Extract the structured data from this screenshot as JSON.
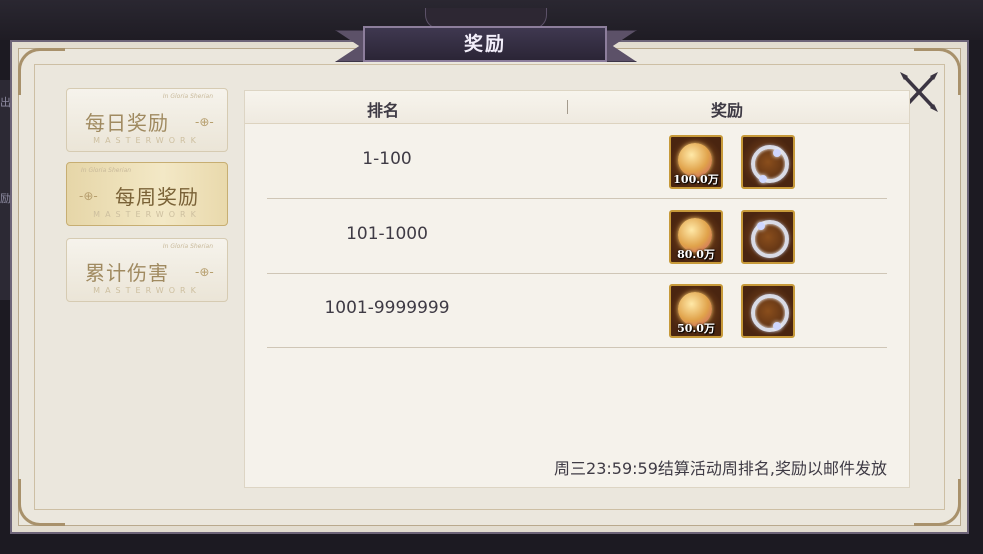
{
  "title": "奖励",
  "tabs": [
    {
      "label": "每日奖励",
      "sub": "MASTERWORK",
      "tiny": "In Gloria Sherian",
      "active": false
    },
    {
      "label": "每周奖励",
      "sub": "MASTERWORK",
      "tiny": "In Gloria Sherian",
      "active": true
    },
    {
      "label": "累计伤害",
      "sub": "MASTERWORK",
      "tiny": "In Gloria Sherian",
      "active": false
    }
  ],
  "table": {
    "headers": {
      "rank": "排名",
      "reward": "奖励"
    },
    "rows": [
      {
        "rank": "1-100",
        "coin_qty": "100.0万",
        "item2": "ring-icon"
      },
      {
        "rank": "101-1000",
        "coin_qty": "80.0万",
        "item2": "ring-icon"
      },
      {
        "rank": "1001-9999999",
        "coin_qty": "50.0万",
        "item2": "ring-icon"
      }
    ]
  },
  "footer_note": "周三23:59:59结算活动周排名,奖励以邮件发放",
  "background_side_text": [
    "出",
    "励"
  ],
  "colors": {
    "accent_gold": "#c79a3a",
    "panel_bg": "#ebe7dd",
    "title_bg": "#3f3850"
  }
}
